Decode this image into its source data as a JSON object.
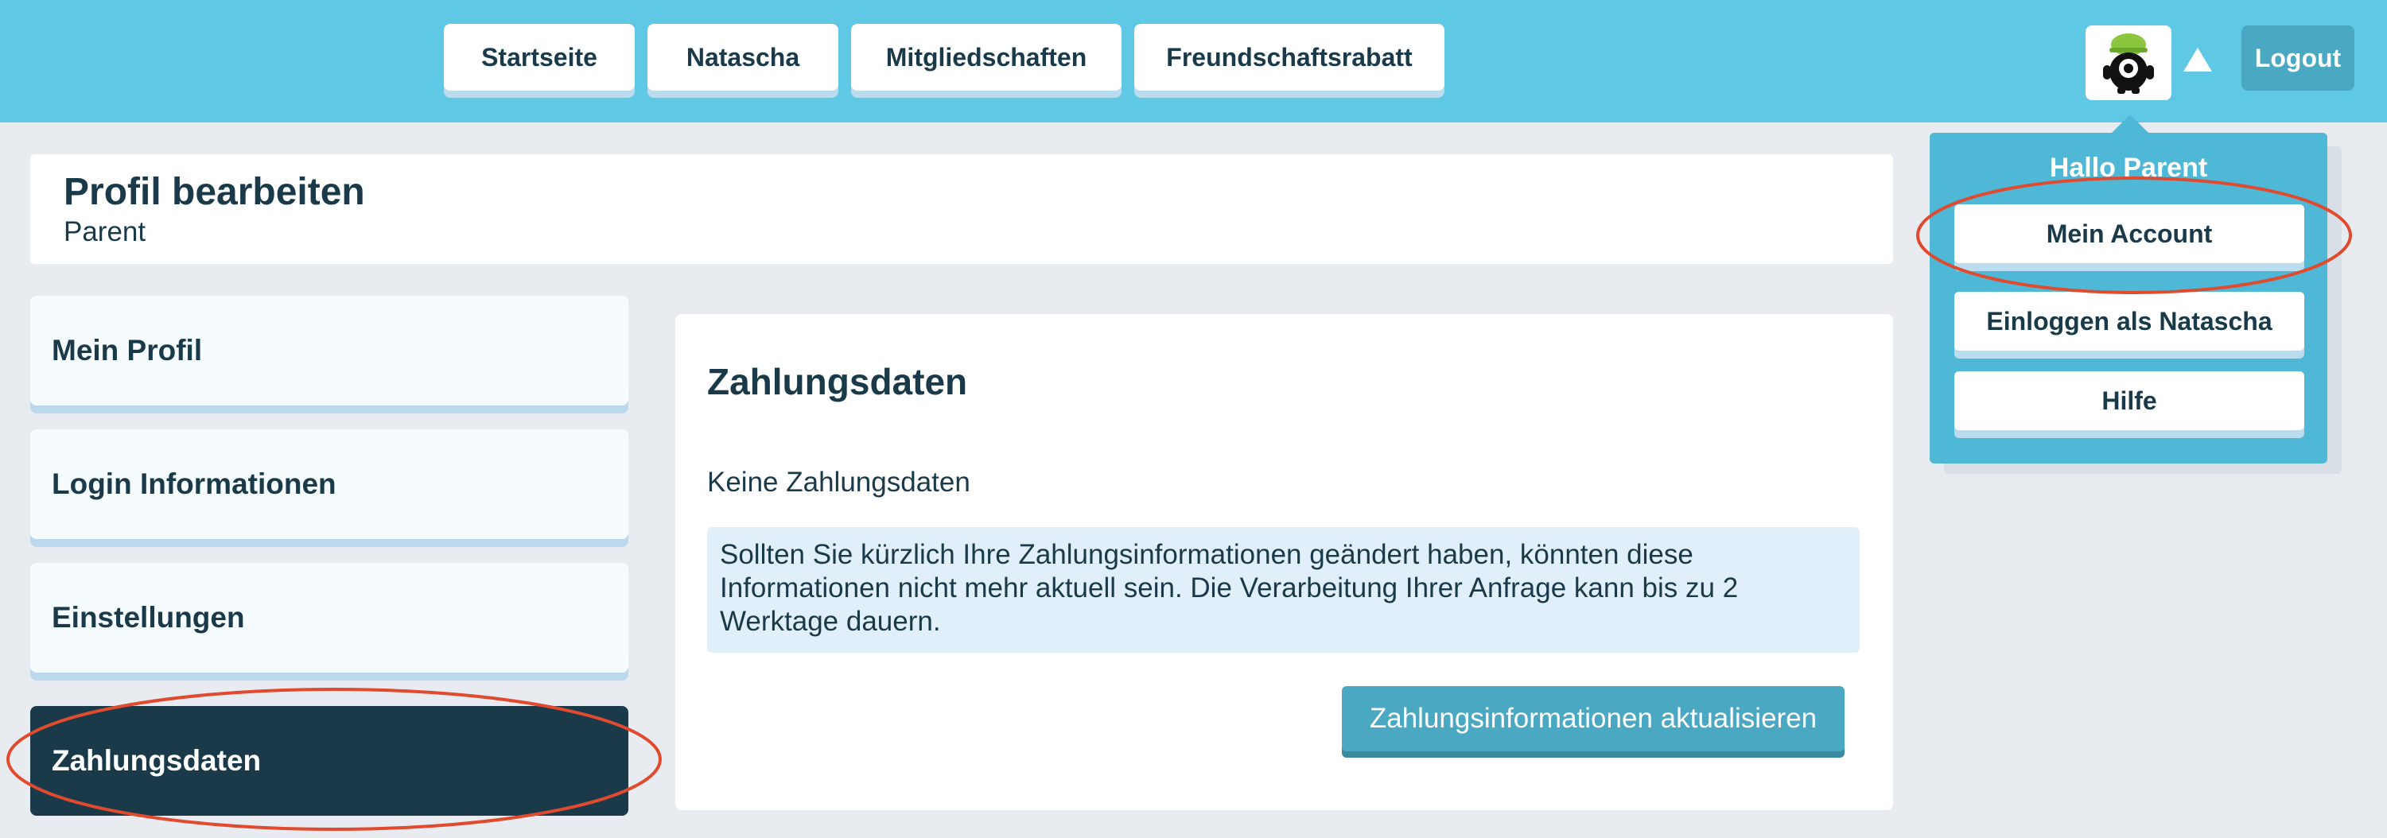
{
  "nav": {
    "items": [
      {
        "label": "Startseite"
      },
      {
        "label": "Natascha"
      },
      {
        "label": "Mitgliedschaften"
      },
      {
        "label": "Freundschaftsrabatt"
      }
    ],
    "logout_label": "Logout",
    "avatar_icon": "monster-avatar-icon"
  },
  "header": {
    "title": "Profil bearbeiten",
    "subtitle": "Parent"
  },
  "sidebar": {
    "items": [
      {
        "label": "Mein Profil"
      },
      {
        "label": "Login Informationen"
      },
      {
        "label": "Einstellungen"
      },
      {
        "label": "Zahlungsdaten",
        "active": true
      }
    ]
  },
  "main": {
    "title": "Zahlungsdaten",
    "empty_text": "Keine Zahlungsdaten",
    "info_text": "Sollten Sie kürzlich Ihre Zahlungsinformationen geändert haben, könnten diese Informationen nicht mehr aktuell sein. Die Verarbeitung Ihrer Anfrage kann bis zu 2 Werktage dauern.",
    "update_button": "Zahlungsinformationen aktualisieren"
  },
  "dropdown": {
    "greeting": "Hallo Parent",
    "items": [
      {
        "label": "Mein Account"
      },
      {
        "label": "Einloggen als Natascha"
      },
      {
        "label": "Hilfe"
      }
    ]
  },
  "colors": {
    "topbar": "#5ec8e5",
    "dark": "#1a3a4a",
    "accent": "#4aa8c2",
    "annotation": "#e04a2f"
  }
}
